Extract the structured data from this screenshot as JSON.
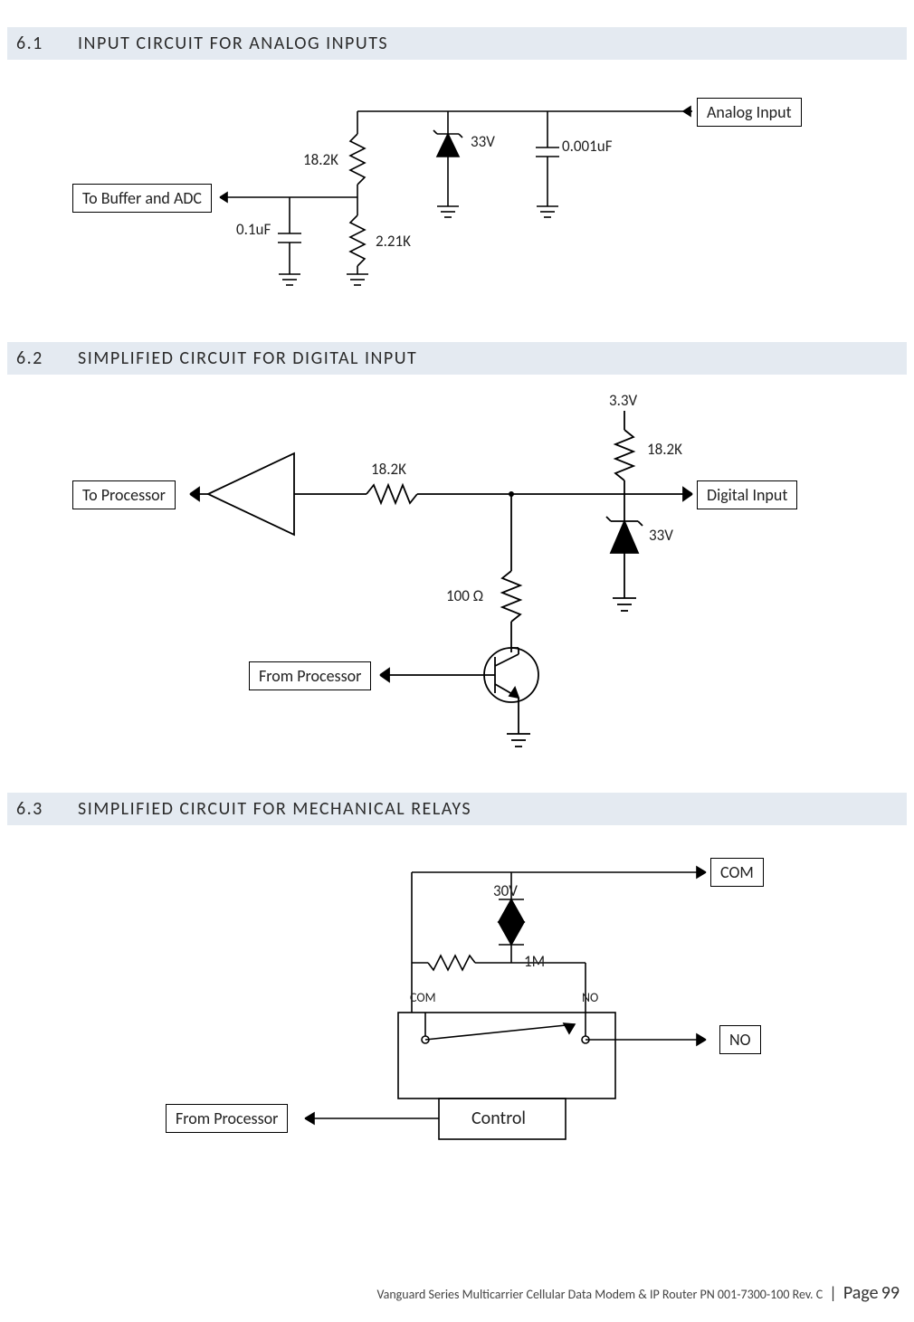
{
  "sections": {
    "s61": {
      "num": "6.1",
      "title": "INPUT CIRCUIT FOR ANALOG INPUTS"
    },
    "s62": {
      "num": "6.2",
      "title": "SIMPLIFIED CIRCUIT FOR DIGITAL INPUT"
    },
    "s63": {
      "num": "6.3",
      "title": "SIMPLIFIED CIRCUIT FOR MECHANICAL RELAYS"
    }
  },
  "d61": {
    "to_buffer": "To Buffer and ADC",
    "analog_in": "Analog Input",
    "r1": "18.2K",
    "r2": "2.21K",
    "c1": "0.1uF",
    "c2": "0.001uF",
    "zener": "33V"
  },
  "d62": {
    "to_proc": "To Processor",
    "from_proc": "From Processor",
    "digital_in": "Digital Input",
    "r_series": "18.2K",
    "r_pullup": "18.2K",
    "r_emitter": "100 Ω",
    "v_supply": "3.3V",
    "zener": "33V"
  },
  "d63": {
    "from_proc": "From Processor",
    "control": "Control",
    "com_pin": "COM",
    "no_pin": "NO",
    "com_sw": "COM",
    "no_sw": "NO",
    "zener": "30V",
    "r_snub": "1M"
  },
  "footer": {
    "pn": "Vanguard Series Multicarrier Cellular Data Modem & IP Router PN 001-7300-100 Rev. C",
    "sep": "|",
    "page_word": "Page",
    "page_num": "99"
  }
}
